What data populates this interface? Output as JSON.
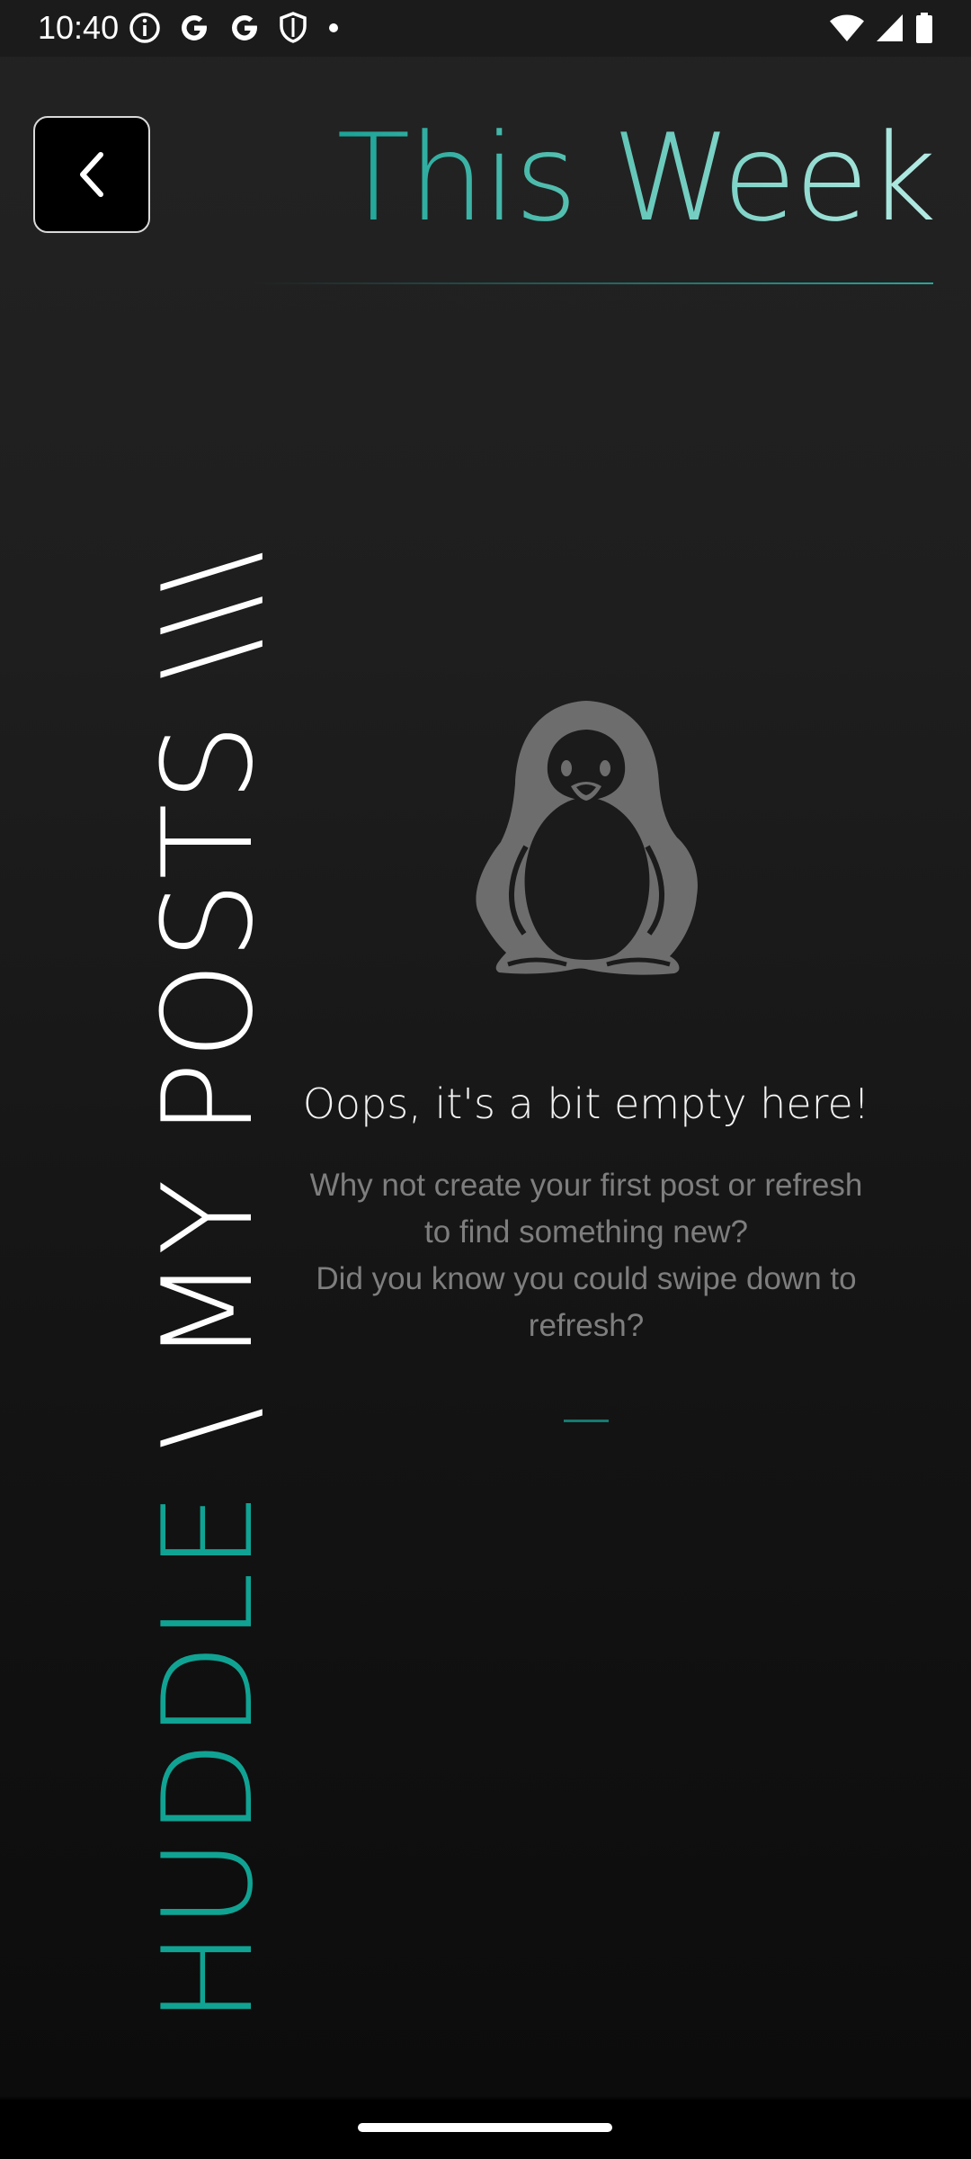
{
  "status_bar": {
    "time": "10:40",
    "left_icons": [
      "info-icon",
      "google-icon",
      "google-icon",
      "shield-icon",
      "dot-icon"
    ],
    "right_icons": [
      "wifi-icon",
      "signal-icon",
      "battery-icon"
    ]
  },
  "header": {
    "back_icon": "chevron-left-icon",
    "title": "This Week"
  },
  "side_label": {
    "app": "HUDDLE",
    "section": " \\ MY POSTS \\\\\\"
  },
  "empty_state": {
    "illustration": "penguin-icon",
    "title": "Oops, it's a bit empty here!",
    "body_lines": [
      "Why not create your first post or refresh",
      "to find something new?",
      "Did you know you could swipe down to",
      "refresh?"
    ]
  },
  "colors": {
    "accent": "#26a69a",
    "background": "#1e1e1e",
    "muted_text": "#7e7e7e"
  }
}
